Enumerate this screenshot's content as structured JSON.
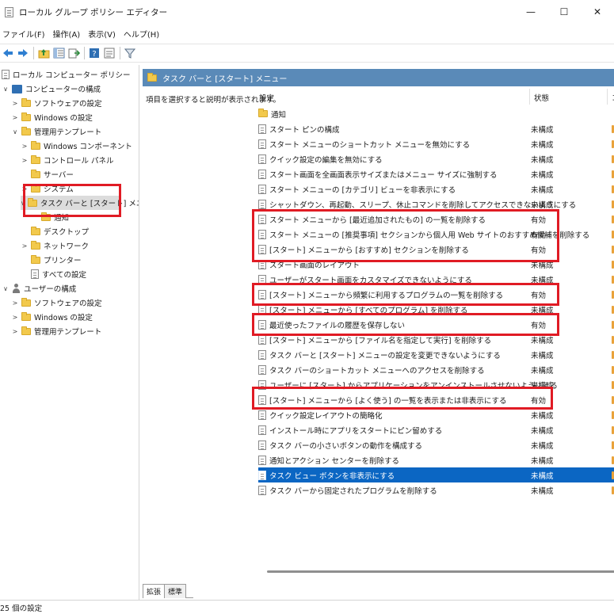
{
  "window": {
    "title": "ローカル グループ ポリシー エディター",
    "minimize": "—",
    "maximize": "☐",
    "close": "✕"
  },
  "menu": [
    "ファイル(F)",
    "操作(A)",
    "表示(V)",
    "ヘルプ(H)"
  ],
  "toolbar": {
    "icons": [
      "back-icon",
      "forward-icon",
      "up-folder-icon",
      "show-hide-tree-icon",
      "export-icon",
      "help-icon",
      "properties-icon",
      "filter-icon"
    ]
  },
  "tree": {
    "root": "ローカル コンピューター ポリシー",
    "computer_config": "コンピューターの構成",
    "software_settings": "ソフトウェアの設定",
    "windows_settings": "Windows の設定",
    "admin_templates": "管理用テンプレート",
    "windows_components": "Windows コンポーネント",
    "control_panel": "コントロール パネル",
    "server": "サーバー",
    "system": "システム",
    "taskbar_start": "タスク バーと [スタート] メニュー",
    "notifications": "通知",
    "desktop": "デスクトップ",
    "network": "ネットワーク",
    "printers": "プリンター",
    "all_settings": "すべての設定",
    "user_config": "ユーザーの構成",
    "user_software_settings": "ソフトウェアの設定",
    "user_windows_settings": "Windows の設定",
    "user_admin_templates": "管理用テンプレート"
  },
  "pane": {
    "header": "タスク バーと [スタート] メニュー",
    "description": "項目を選択すると説明が表示されます。",
    "col_setting": "設定",
    "col_state": "状態",
    "col_extra": "コ"
  },
  "settings": [
    {
      "name": "通知",
      "state": "",
      "folder": true
    },
    {
      "name": "スタート ピンの構成",
      "state": "未構成"
    },
    {
      "name": "スタート メニューのショートカット メニューを無効にする",
      "state": "未構成"
    },
    {
      "name": "クイック設定の編集を無効にする",
      "state": "未構成"
    },
    {
      "name": "スタート画面を全画面表示サイズまたはメニュー サイズに強制する",
      "state": "未構成"
    },
    {
      "name": "スタート メニューの [カテゴリ] ビューを非表示にする",
      "state": "未構成"
    },
    {
      "name": "シャットダウン、再起動、スリープ、休止コマンドを削除してアクセスできないようにする",
      "state": "未構成"
    },
    {
      "name": "スタート メニューから [最近追加されたもの] の一覧を削除する",
      "state": "有効"
    },
    {
      "name": "スタート メニューの [推奨事項] セクションから個人用 Web サイトのおすすめ候補を削除する",
      "state": "有効"
    },
    {
      "name": "[スタート] メニューから [おすすめ] セクションを削除する",
      "state": "有効"
    },
    {
      "name": "スタート画面のレイアウト",
      "state": "未構成"
    },
    {
      "name": "ユーザーがスタート画面をカスタマイズできないようにする",
      "state": "未構成"
    },
    {
      "name": "[スタート] メニューから頻繁に利用するプログラムの一覧を削除する",
      "state": "有効"
    },
    {
      "name": "[スタート] メニューから [すべてのプログラム] を削除する",
      "state": "未構成"
    },
    {
      "name": "最近使ったファイルの履歴を保存しない",
      "state": "有効"
    },
    {
      "name": "[スタート] メニューから [ファイル名を指定して実行] を削除する",
      "state": "未構成"
    },
    {
      "name": "タスク バーと [スタート] メニューの設定を変更できないようにする",
      "state": "未構成"
    },
    {
      "name": "タスク バーのショートカット メニューへのアクセスを削除する",
      "state": "未構成"
    },
    {
      "name": "ユーザーに [スタート] からアプリケーションをアンインストールさせないようにする",
      "state": "未構成"
    },
    {
      "name": "[スタート] メニューから [よく使う] の一覧を表示または非表示にする",
      "state": "有効"
    },
    {
      "name": "クイック設定レイアウトの簡略化",
      "state": "未構成"
    },
    {
      "name": "インストール時にアプリをスタートにピン留めする",
      "state": "未構成"
    },
    {
      "name": "タスク バーの小さいボタンの動作を構成する",
      "state": "未構成"
    },
    {
      "name": "通知とアクション センターを削除する",
      "state": "未構成"
    },
    {
      "name": "タスク ビュー ボタンを非表示にする",
      "state": "未構成",
      "selected": true
    },
    {
      "name": "タスク バーから固定されたプログラムを削除する",
      "state": "未構成"
    }
  ],
  "tabs": [
    "拡張",
    "標準"
  ],
  "status": "25 個の設定",
  "colors": {
    "accent": "#0b66c3",
    "header_band": "#5a8ab8",
    "annotation": "#e01b24"
  }
}
